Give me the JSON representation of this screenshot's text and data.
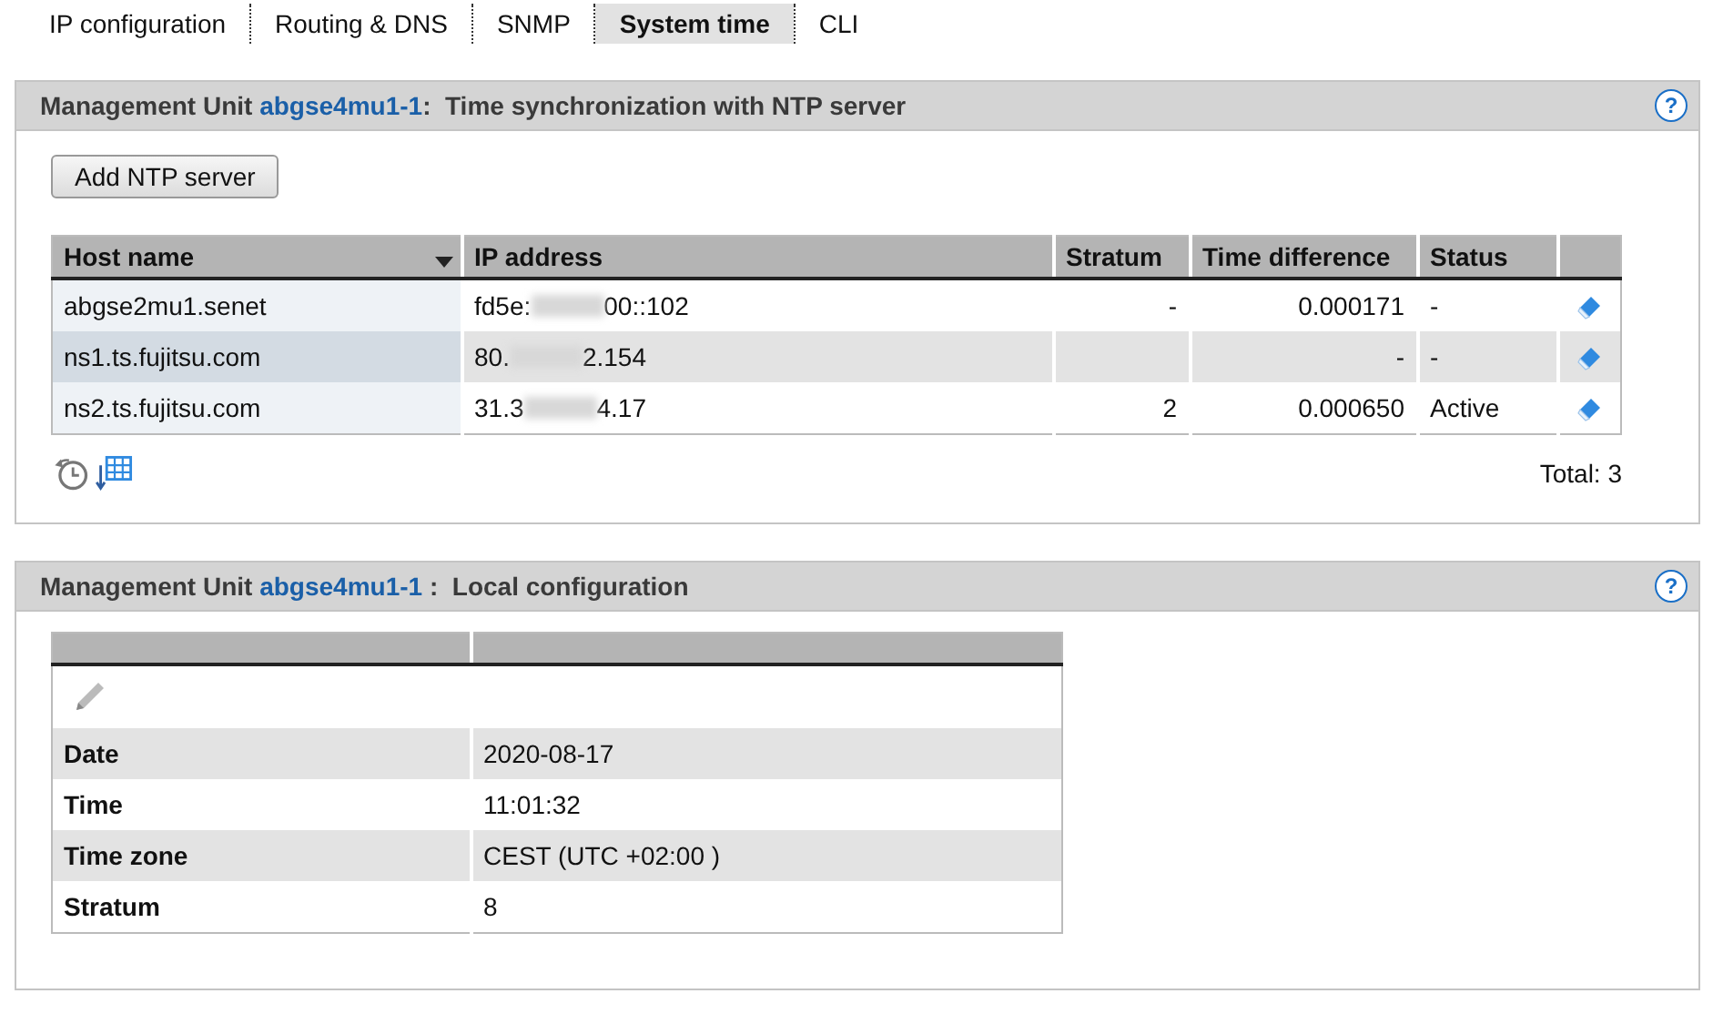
{
  "tabs": [
    {
      "label": "IP configuration",
      "selected": false
    },
    {
      "label": "Routing & DNS",
      "selected": false
    },
    {
      "label": "SNMP",
      "selected": false
    },
    {
      "label": "System time",
      "selected": true
    },
    {
      "label": "CLI",
      "selected": false
    }
  ],
  "ntp_panel": {
    "prefix": "Management Unit",
    "unit": "abgse4mu1-1",
    "separator": ":",
    "title": "Time synchronization with NTP server",
    "help": "?",
    "add_button": "Add NTP server",
    "columns": [
      {
        "label": "Host name",
        "sorted": true
      },
      {
        "label": "IP address",
        "sorted": false
      },
      {
        "label": "Stratum",
        "sorted": false
      },
      {
        "label": "Time difference",
        "sorted": false
      },
      {
        "label": "Status",
        "sorted": false
      },
      {
        "sorted": false
      }
    ],
    "rows": [
      {
        "host": "abgse2mu1.senet",
        "ip_start": "fd5e:",
        "ip_end": "00::102",
        "stratum": "-",
        "time_difference": "0.000171",
        "status": "-"
      },
      {
        "host": "ns1.ts.fujitsu.com",
        "ip_start": "80.",
        "ip_end": "2.154",
        "stratum": "",
        "time_difference": "-",
        "status": "-"
      },
      {
        "host": "ns2.ts.fujitsu.com",
        "ip_start": "31.3",
        "ip_end": "4.17",
        "stratum": "2",
        "time_difference": "0.000650",
        "status": "Active"
      }
    ],
    "total": "Total: 3"
  },
  "local_panel": {
    "prefix": "Management Unit",
    "unit": "abgse4mu1-1",
    "separator": " :",
    "title": "Local configuration",
    "help": "?",
    "rows": [
      {
        "label": "Date",
        "value": "2020-08-17"
      },
      {
        "label": "Time",
        "value": "11:01:32"
      },
      {
        "label": "Time zone",
        "value": "CEST (UTC +02:00 )"
      },
      {
        "label": "Stratum",
        "value": "8"
      }
    ]
  }
}
